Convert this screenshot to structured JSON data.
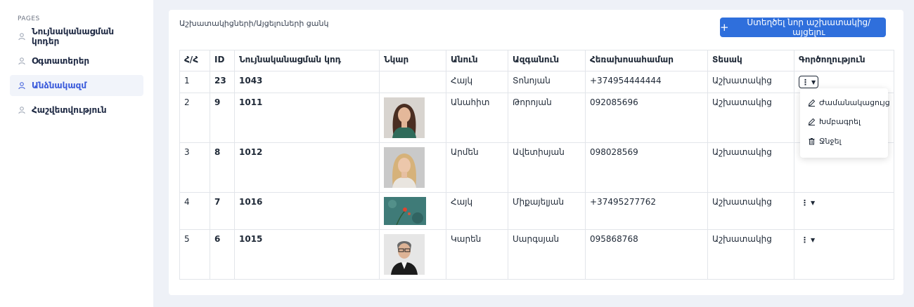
{
  "sidebar": {
    "section_label": "PAGES",
    "items": [
      {
        "label": "Նույնականացման կոդեր",
        "icon": "user-icon",
        "active": false
      },
      {
        "label": "Օգտատերեր",
        "icon": "user-icon",
        "active": false
      },
      {
        "label": "Անձնակազմ",
        "icon": "user-icon",
        "active": true
      },
      {
        "label": "Հաշվետվություն",
        "icon": "user-icon",
        "active": false
      }
    ]
  },
  "main": {
    "title": "Աշխատակիցների/Այցելուների ցանկ",
    "create_button_label": "Ստեղծել նոր աշխատակից/այցելու",
    "create_button_icon": "plus-icon",
    "table": {
      "headers": [
        "Հ/Հ",
        "ID",
        "Նույնականացման կոդ",
        "Նկար",
        "Անուն",
        "Ազգանուն",
        "Հեռախոսահամար",
        "Տեսակ",
        "Գործողություն"
      ],
      "rows": [
        {
          "index": "1",
          "id": "23",
          "code": "1043",
          "photo": "none",
          "first_name": "Հայկ",
          "last_name": "Տոնոյան",
          "phone": "+374954444444",
          "type": "Աշխատակից"
        },
        {
          "index": "2",
          "id": "9",
          "code": "1011",
          "photo": "woman-brunette-photo",
          "first_name": "Անահիտ",
          "last_name": "Թորոյան",
          "phone": "092085696",
          "type": "Աշխատակից"
        },
        {
          "index": "3",
          "id": "8",
          "code": "1012",
          "photo": "woman-blonde-photo",
          "first_name": "Արմեն",
          "last_name": "Ավետիսյան",
          "phone": "098028569",
          "type": "Աշխատակից"
        },
        {
          "index": "4",
          "id": "7",
          "code": "1016",
          "photo": "flower-photo",
          "first_name": "Հայկ",
          "last_name": "Միքայելյան",
          "phone": "+37495277762",
          "type": "Աշխատակից"
        },
        {
          "index": "5",
          "id": "6",
          "code": "1015",
          "photo": "man-glasses-photo",
          "first_name": "Կարեն",
          "last_name": "Սարգսյան",
          "phone": "095868768",
          "type": "Աշխատակից"
        }
      ]
    },
    "dropdown": {
      "items": [
        {
          "label": "Ժամանակացույց",
          "icon": "pencil-icon"
        },
        {
          "label": "Խմբագրել",
          "icon": "pencil-icon"
        },
        {
          "label": "Ջնջել",
          "icon": "trash-icon"
        }
      ]
    }
  },
  "colors": {
    "accent": "#2f6fdc",
    "page_bg": "#eef1f7",
    "active_nav_text": "#3b5bdb"
  }
}
